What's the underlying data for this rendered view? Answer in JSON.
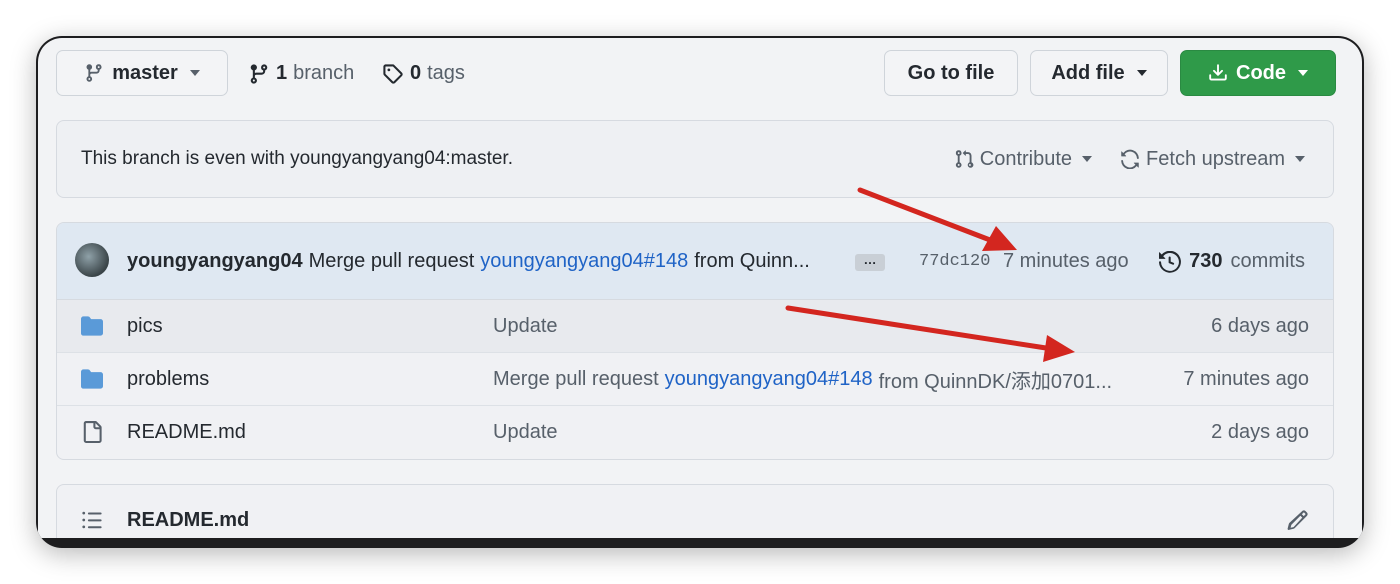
{
  "topbar": {
    "branch_button": "master",
    "branches_count": "1",
    "branches_label": "branch",
    "tags_count": "0",
    "tags_label": "tags",
    "go_to_file": "Go to file",
    "add_file": "Add file",
    "code": "Code"
  },
  "status": {
    "message": "This branch is even with youngyangyang04:master.",
    "contribute": "Contribute",
    "fetch_upstream": "Fetch upstream"
  },
  "latest_commit": {
    "author": "youngyangyang04",
    "message_prefix": "Merge pull request",
    "pr_link": "youngyangyang04#148",
    "message_suffix": "from Quinn...",
    "ellipsis": "…",
    "sha": "77dc120",
    "time": "7 minutes ago",
    "commits_count": "730",
    "commits_label": "commits"
  },
  "files": [
    {
      "type": "folder",
      "name": "pics",
      "message_prefix": "Update",
      "message_link": "",
      "message_suffix": "",
      "age": "6 days ago"
    },
    {
      "type": "folder",
      "name": "problems",
      "message_prefix": "Merge pull request",
      "message_link": "youngyangyang04#148",
      "message_suffix": "from QuinnDK/添加0701...",
      "age": "7 minutes ago"
    },
    {
      "type": "file",
      "name": "README.md",
      "message_prefix": "Update",
      "message_link": "",
      "message_suffix": "",
      "age": "2 days ago"
    }
  ],
  "readme": {
    "title": "README.md"
  },
  "colors": {
    "accent_green": "#2f9a49",
    "link_blue": "#1f63c6",
    "annotation_red": "#d3261f"
  },
  "icons": [
    "git-branch-icon",
    "tag-icon",
    "download-icon",
    "pull-request-icon",
    "sync-icon",
    "history-icon",
    "folder-icon",
    "file-icon",
    "list-icon",
    "pencil-icon"
  ]
}
